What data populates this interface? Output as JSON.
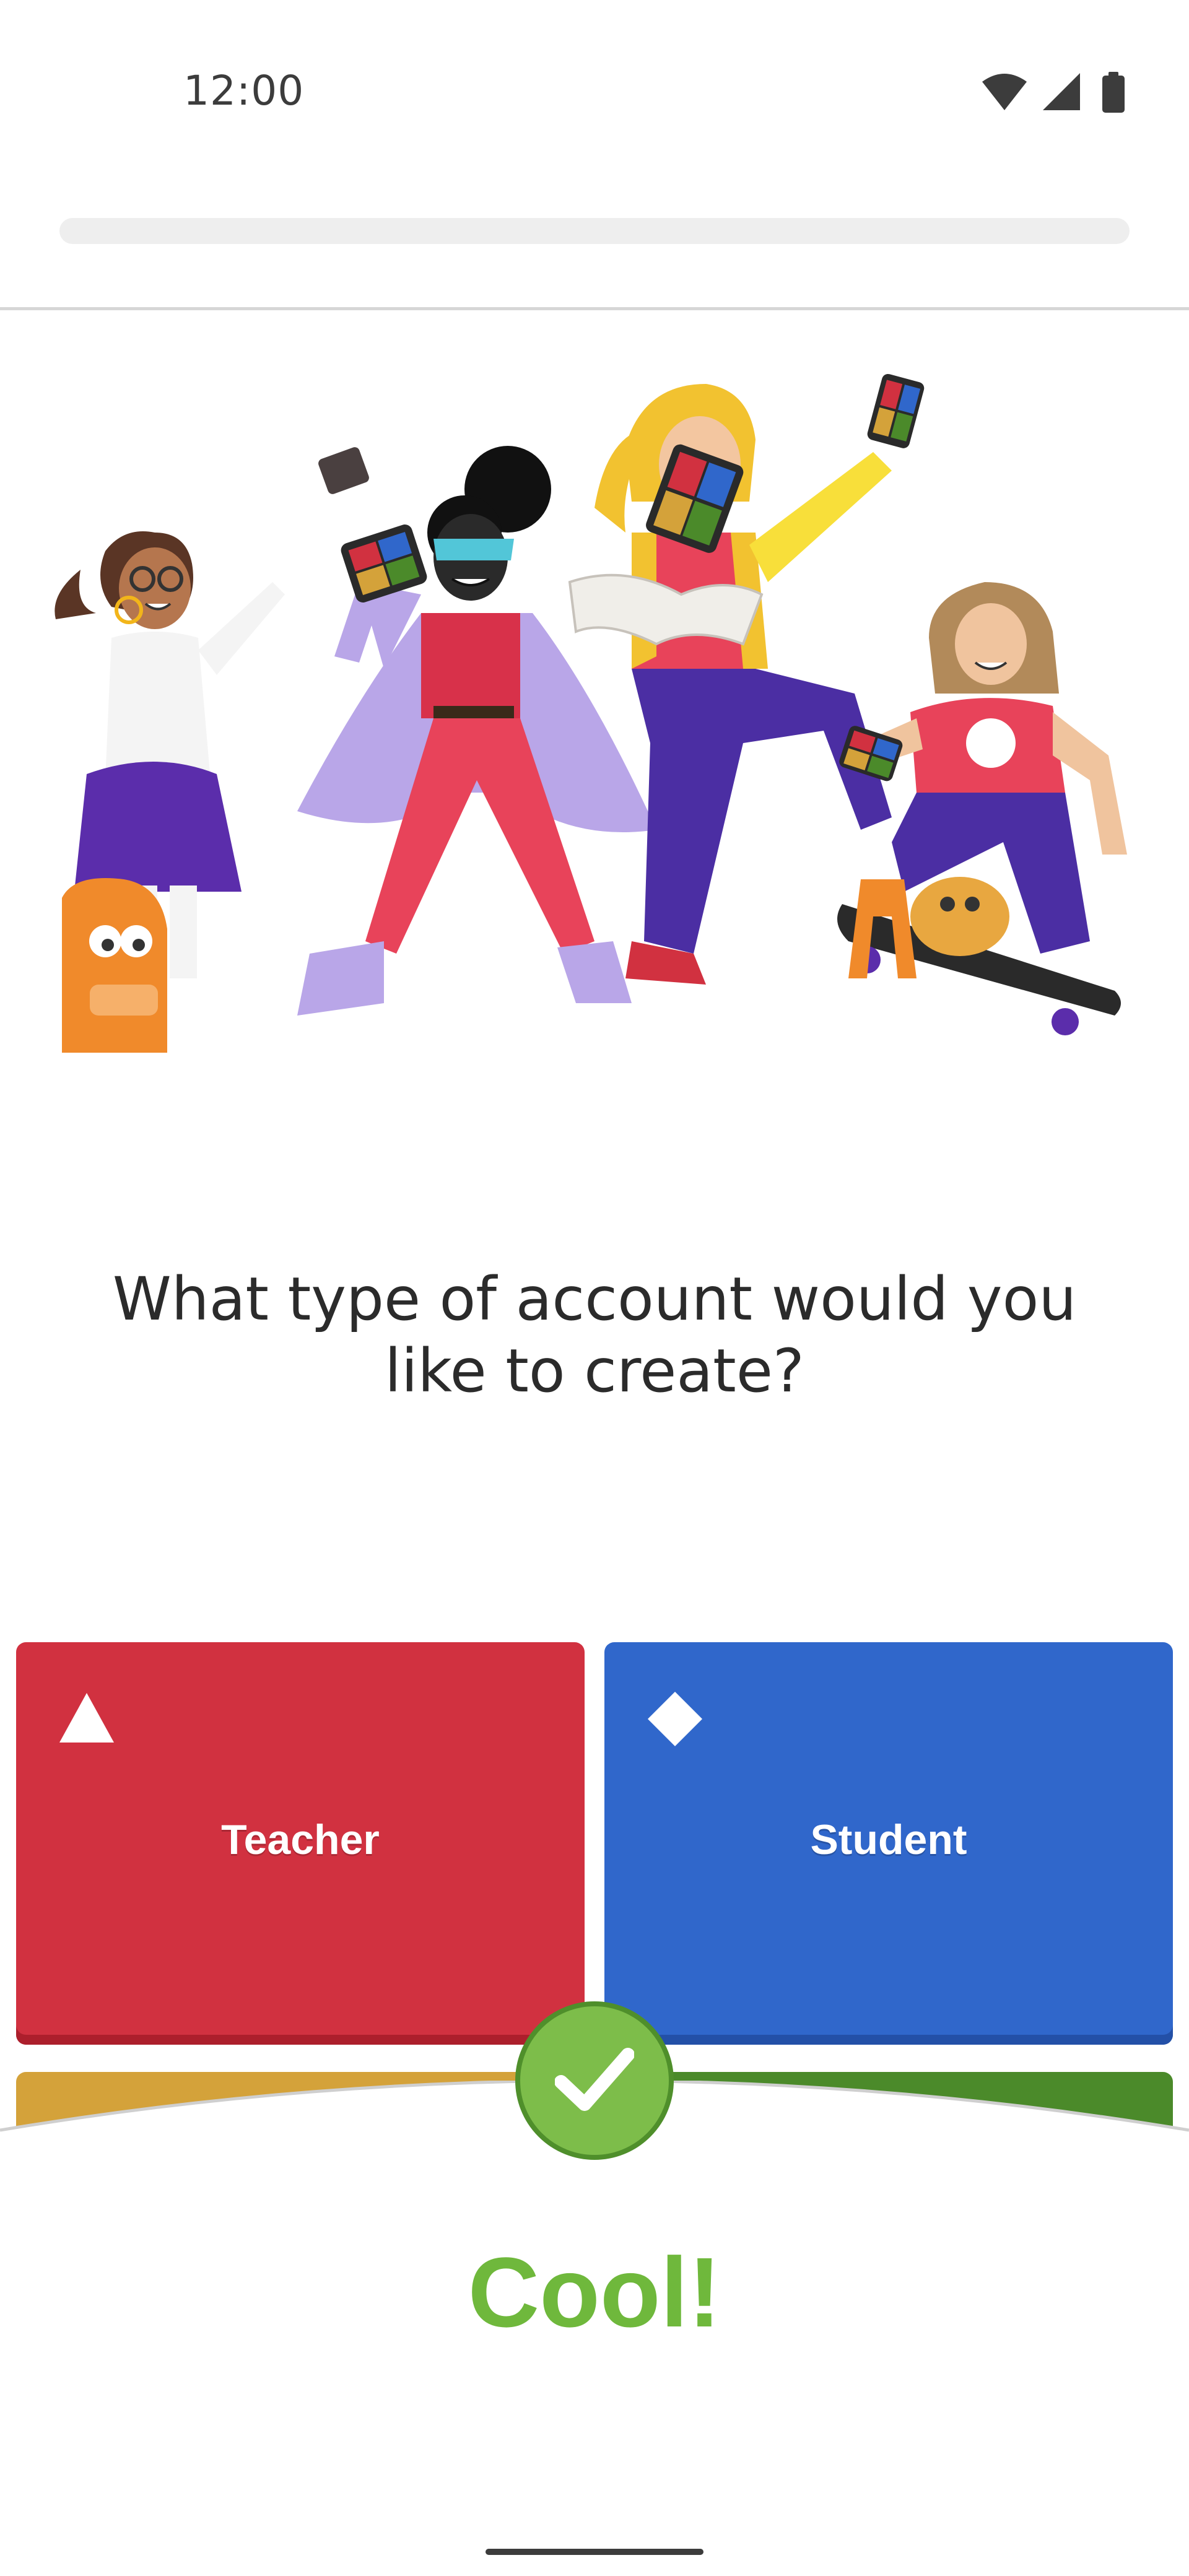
{
  "status_bar": {
    "time": "12:00",
    "icons": [
      "wifi-icon",
      "cellular-signal-icon",
      "battery-icon"
    ]
  },
  "onboarding": {
    "progress_percent": 0,
    "question": "What type of account would you like to create?",
    "options": [
      {
        "label": "Teacher",
        "shape": "triangle",
        "color": "#d13140"
      },
      {
        "label": "Student",
        "shape": "diamond",
        "color": "#3067cb"
      }
    ],
    "hidden_option_colors": [
      "#d4a23a",
      "#4b8a2a"
    ]
  },
  "feedback": {
    "icon": "checkmark-icon",
    "message": "Cool!",
    "color": "#6fb83c"
  }
}
